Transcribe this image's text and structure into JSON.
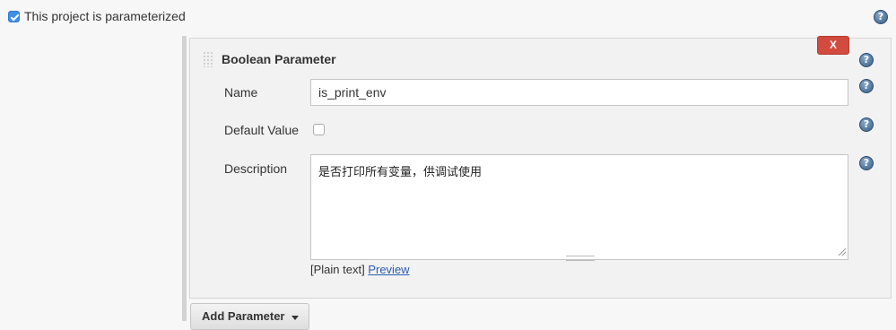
{
  "parameterized": {
    "label": "This project is parameterized",
    "checked": true
  },
  "help_glyph": "?",
  "parameter": {
    "title": "Boolean Parameter",
    "delete_label": "X",
    "name": {
      "label": "Name",
      "value": "is_print_env"
    },
    "default_value": {
      "label": "Default Value",
      "checked": false
    },
    "description": {
      "label": "Description",
      "value": "是否打印所有变量，供调试使用",
      "format": "[Plain text]",
      "preview_link": "Preview"
    }
  },
  "add_parameter_label": "Add Parameter",
  "colors": {
    "checkbox_blue": "#3d8fe8",
    "delete_red": "#d24b3f",
    "link_blue": "#2a5db0"
  }
}
